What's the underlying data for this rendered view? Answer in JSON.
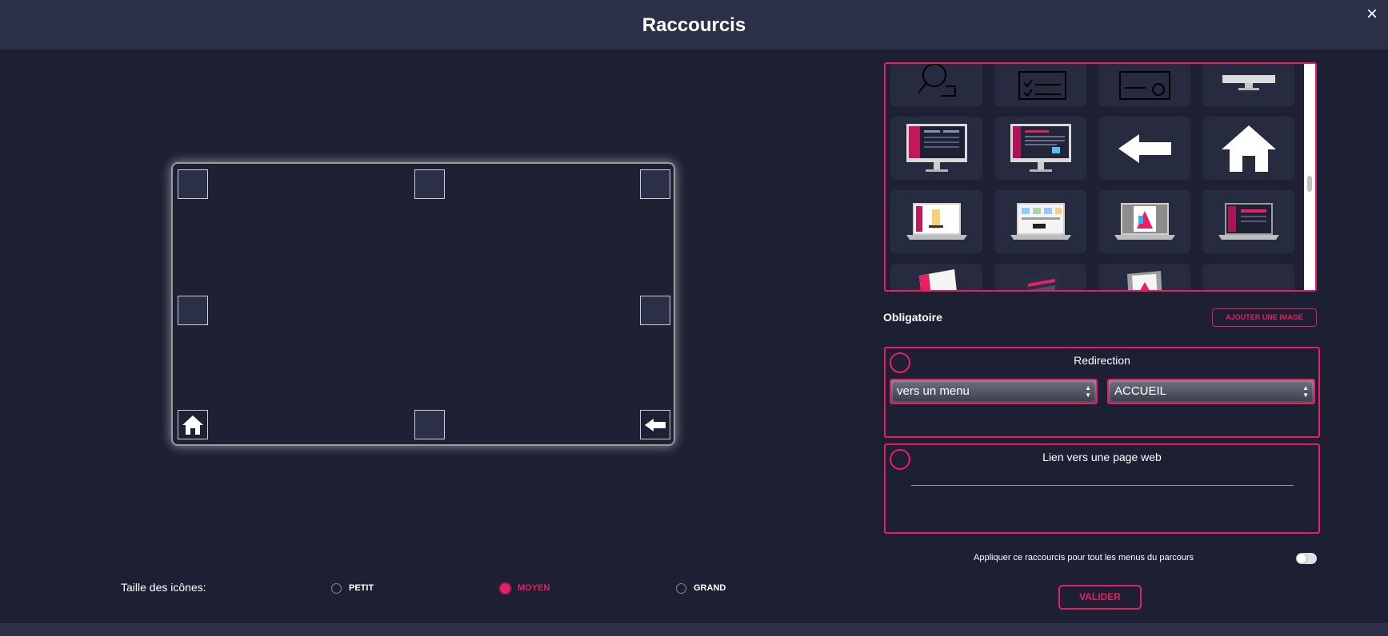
{
  "modal": {
    "title": "Raccourcis",
    "close_icon": "×"
  },
  "preview": {
    "slots": [
      {
        "id": "top-left",
        "icon": null
      },
      {
        "id": "top-center",
        "icon": null
      },
      {
        "id": "top-right",
        "icon": null
      },
      {
        "id": "middle-left",
        "icon": null
      },
      {
        "id": "middle-right",
        "icon": null
      },
      {
        "id": "bottom-left",
        "icon": "home-icon"
      },
      {
        "id": "bottom-center",
        "icon": null
      },
      {
        "id": "bottom-right",
        "icon": "arrow-left-icon"
      }
    ]
  },
  "gallery": {
    "thumbnails": [
      "magnifier-document-icon",
      "checklist-icon",
      "card-icon",
      "monitor-image",
      "monitor-dashboard-image",
      "monitor-dashboard-image",
      "arrow-left-icon",
      "home-icon",
      "laptop-image",
      "laptop-image",
      "laptop-image",
      "laptop-image",
      "laptop-image",
      "laptop-image",
      "laptop-image",
      "mini-pc-image"
    ]
  },
  "obligatoire_label": "Obligatoire",
  "add_image_label": "AJOUTER UNE IMAGE",
  "redirection": {
    "title": "Redirection",
    "type_value": "vers un menu",
    "target_value": "ACCUEIL"
  },
  "web_link": {
    "title": "Lien vers une page web",
    "value": ""
  },
  "apply_all_label": "Appliquer ce raccourcis pour tout les menus du parcours",
  "apply_all_enabled": false,
  "validate_label": "VALIDER",
  "icon_size": {
    "label": "Taille des icônes:",
    "options": [
      "PETIT",
      "MOYEN",
      "GRAND"
    ],
    "selected": "MOYEN"
  },
  "colors": {
    "accent": "#e91e63",
    "background": "#1d2033",
    "header": "#2b2f48"
  }
}
